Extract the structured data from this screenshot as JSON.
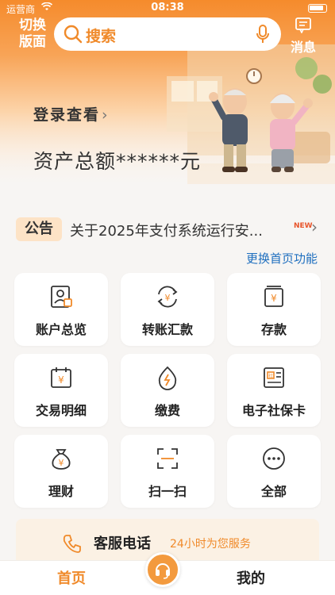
{
  "status_bar": {
    "carrier": "运营商",
    "time": "08:38"
  },
  "header": {
    "switch_label": "切换版面",
    "search_placeholder": "搜索",
    "message_label": "消息"
  },
  "account": {
    "login_prompt": "登录查看",
    "assets_text": "资产总额******元"
  },
  "notice": {
    "tag": "公告",
    "text": "关于2025年支付系统运行安...",
    "new_badge": "NEW"
  },
  "change_home_link": "更换首页功能",
  "menu": [
    {
      "label": "账户总览",
      "icon": "account-overview-icon"
    },
    {
      "label": "转账汇款",
      "icon": "transfer-icon"
    },
    {
      "label": "存款",
      "icon": "deposit-icon"
    },
    {
      "label": "交易明细",
      "icon": "transaction-details-icon"
    },
    {
      "label": "缴费",
      "icon": "payment-icon"
    },
    {
      "label": "电子社保卡",
      "icon": "social-security-card-icon"
    },
    {
      "label": "理财",
      "icon": "wealth-management-icon"
    },
    {
      "label": "扫一扫",
      "icon": "scan-icon"
    },
    {
      "label": "全部",
      "icon": "more-icon"
    }
  ],
  "service": {
    "title": "客服电话",
    "subtitle": "24小时为您服务"
  },
  "tabbar": {
    "home": "首页",
    "mine": "我的"
  },
  "colors": {
    "accent": "#f08a2a",
    "link": "#1f6fbf",
    "icon_stroke": "#333333"
  }
}
